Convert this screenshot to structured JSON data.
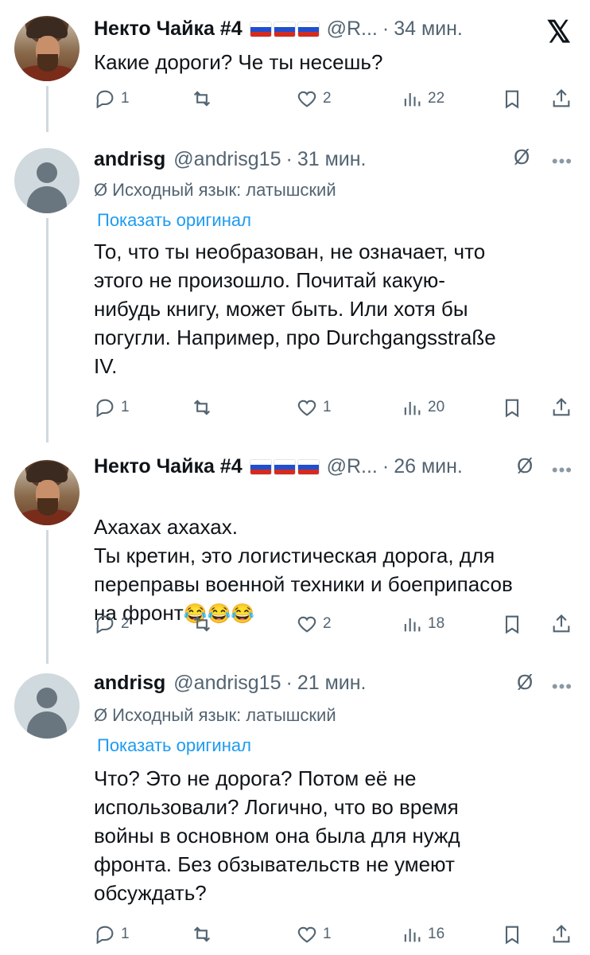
{
  "x_logo": "𝕏",
  "tweets": [
    {
      "name": "Некто Чайка #4",
      "handle": "@R...",
      "time": "34 мин.",
      "flags": 3,
      "text": "Какие дороги? Че ты несешь?",
      "replies": "1",
      "retweets": "",
      "likes": "2",
      "views": "22"
    },
    {
      "name": "andrisg",
      "handle": "@andrisg15",
      "time": "31 мин.",
      "lang_label": "Исходный язык: латышский",
      "show_original": "Показать оригинал",
      "text": "То, что ты необразован, не означает, что\nэтого не произошло. Почитай какую-\nнибудь книгу, может быть. Или хотя бы\nпогугли. Например, про Durchgangsstraße\nIV.",
      "replies": "1",
      "retweets": "",
      "likes": "1",
      "views": "20"
    },
    {
      "name": "Некто Чайка #4",
      "handle": "@R...",
      "time": "26 мин.",
      "flags": 3,
      "text": "Ахахах ахахах.\nТы кретин, это логистическая дорога, для\nпереправы военной техники и боеприпасов\nна фронт",
      "emojis": "😂😂😂",
      "replies": "2",
      "retweets": "",
      "likes": "2",
      "views": "18"
    },
    {
      "name": "andrisg",
      "handle": "@andrisg15",
      "time": "21 мин.",
      "lang_label": "Исходный язык: латышский",
      "show_original": "Показать оригинал",
      "text": "Что? Это не дорога? Потом её не\nиспользовали? Логично, что во время\nвойны в основном она была для нужд\nфронта. Без обзывательств не умеют\nобсуждать?",
      "replies": "1",
      "retweets": "",
      "likes": "1",
      "views": "16"
    }
  ]
}
